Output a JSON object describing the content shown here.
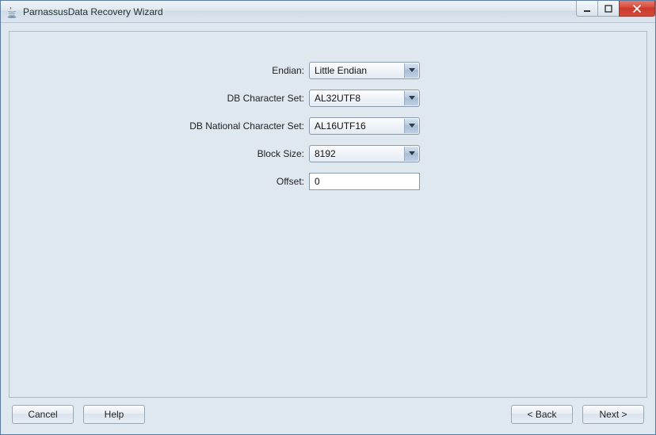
{
  "window": {
    "title": "ParnassusData Recovery Wizard"
  },
  "form": {
    "endian": {
      "label": "Endian:",
      "value": "Little Endian"
    },
    "charset": {
      "label": "DB Character Set:",
      "value": "AL32UTF8"
    },
    "ncharset": {
      "label": "DB National Character Set:",
      "value": "AL16UTF16"
    },
    "block_size": {
      "label": "Block Size:",
      "value": "8192"
    },
    "offset": {
      "label": "Offset:",
      "value": "0"
    }
  },
  "buttons": {
    "cancel": "Cancel",
    "help": "Help",
    "back": "<  Back",
    "next": "Next  >"
  }
}
